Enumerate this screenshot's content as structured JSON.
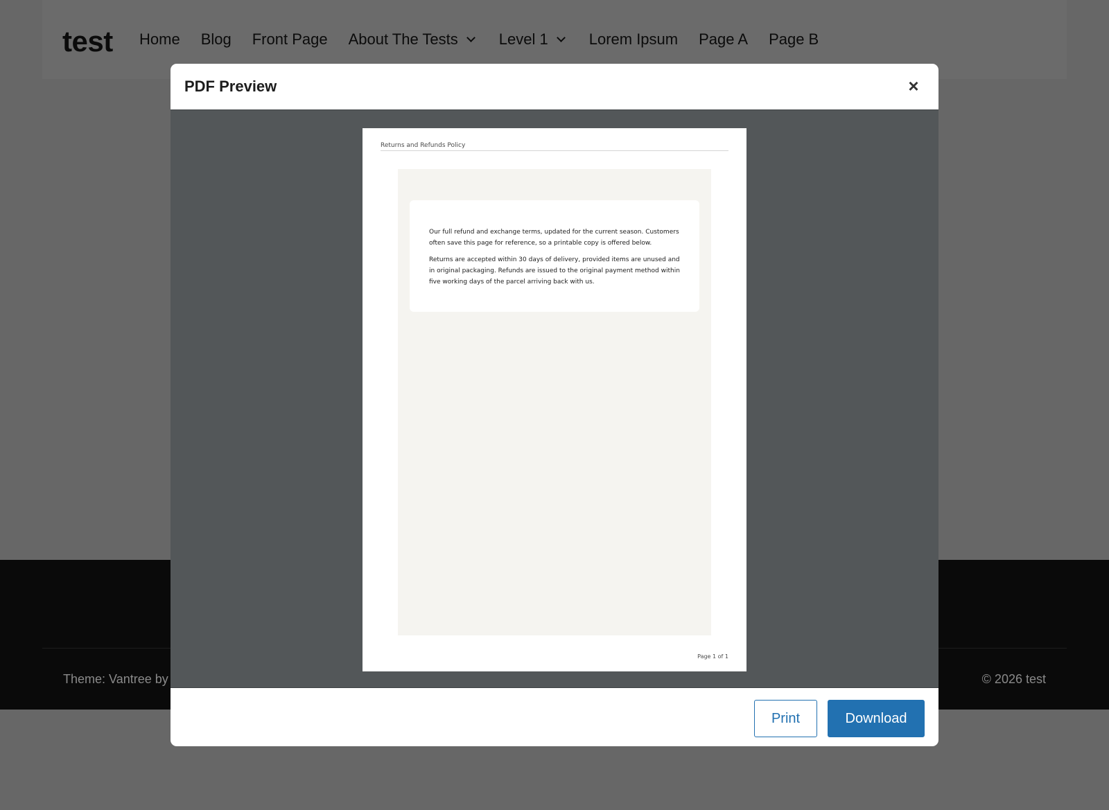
{
  "site": {
    "title": "test",
    "nav": [
      {
        "label": "Home",
        "has_submenu": false
      },
      {
        "label": "Blog",
        "has_submenu": false
      },
      {
        "label": "Front Page",
        "has_submenu": false
      },
      {
        "label": "About The Tests",
        "has_submenu": true
      },
      {
        "label": "Level 1",
        "has_submenu": true
      },
      {
        "label": "Lorem Ipsum",
        "has_submenu": false
      },
      {
        "label": "Page A",
        "has_submenu": false
      },
      {
        "label": "Page B",
        "has_submenu": false
      }
    ],
    "footer_left": "Theme: Vantree by",
    "footer_right": "© 2026 test"
  },
  "modal": {
    "title": "PDF Preview",
    "close_icon": "×",
    "print_label": "Print",
    "download_label": "Download",
    "document": {
      "header": "Returns and Refunds Policy",
      "paragraphs": [
        "Our full refund and exchange terms, updated for the current season. Customers often save this page for reference, so a printable copy is offered below.",
        "Returns are accepted within 30 days of delivery, provided items are unused and in original packaging. Refunds are issued to the original payment method within five working days of the parcel arriving back with us."
      ],
      "page_indicator": "Page 1 of 1"
    }
  },
  "colors": {
    "overlay_bg": "#676767",
    "viewer_bg": "#535759",
    "accent": "#2271b1",
    "footer_bg": "#0a0a0a"
  }
}
